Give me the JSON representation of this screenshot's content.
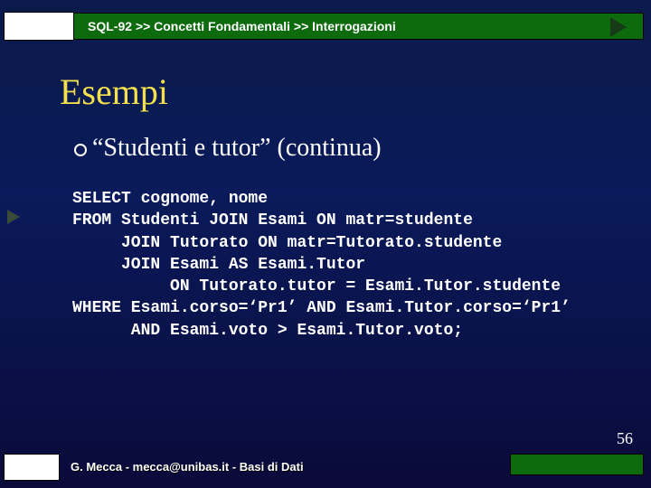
{
  "breadcrumb": "SQL-92 >> Concetti Fondamentali >> Interrogazioni",
  "title": "Esempi",
  "subtitle": "“Studenti e tutor” (continua)",
  "code": "SELECT cognome, nome\nFROM Studenti JOIN Esami ON matr=studente\n     JOIN Tutorato ON matr=Tutorato.studente\n     JOIN Esami AS Esami.Tutor\n          ON Tutorato.tutor = Esami.Tutor.studente\nWHERE Esami.corso=‘Pr1’ AND Esami.Tutor.corso=‘Pr1’\n      AND Esami.voto > Esami.Tutor.voto;",
  "footer": "G. Mecca - mecca@unibas.it - Basi di Dati",
  "page_number": "56"
}
